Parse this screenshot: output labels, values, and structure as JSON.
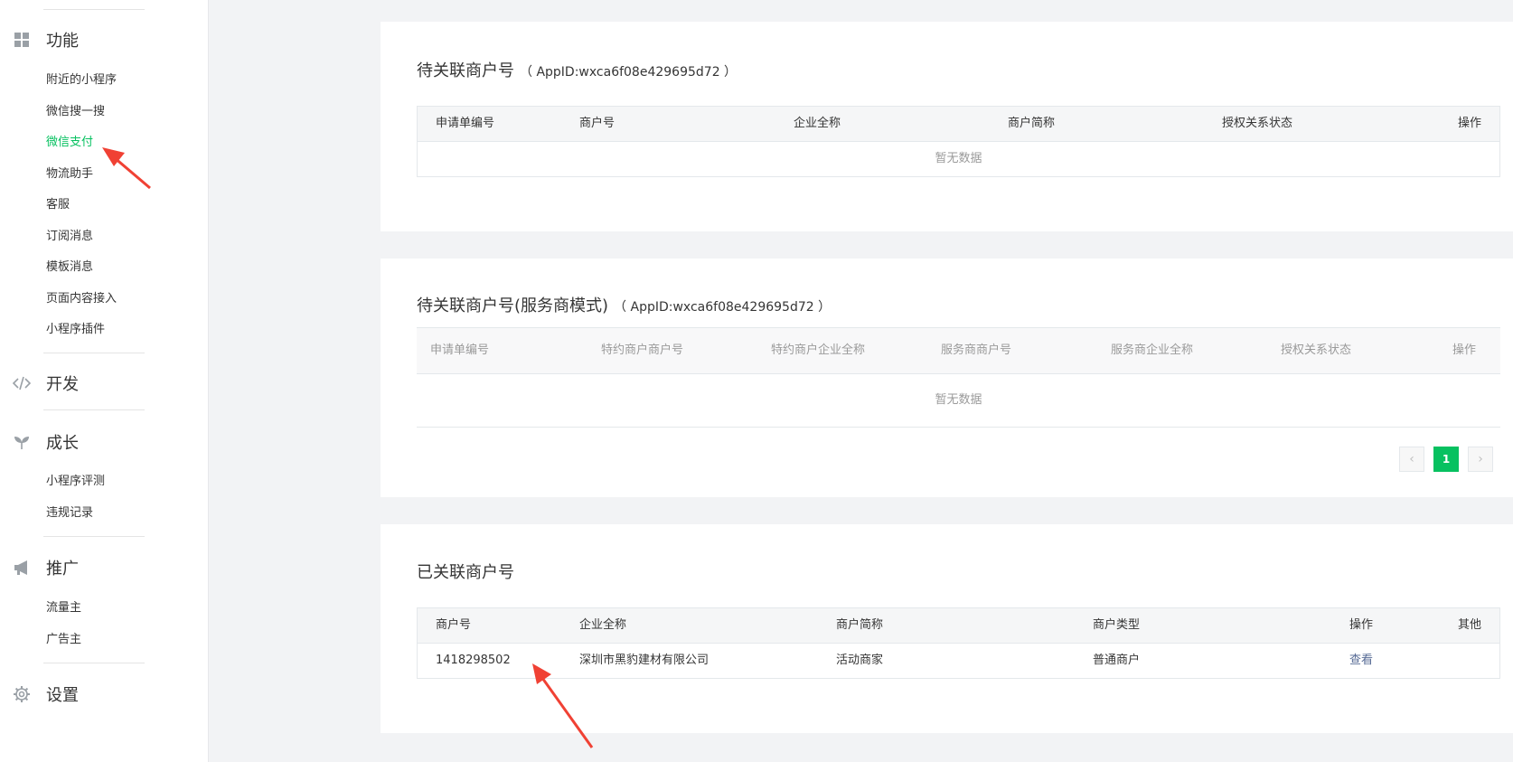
{
  "sidebar": {
    "sections": [
      {
        "title": "功能",
        "icon": "grid-icon"
      },
      {
        "title": "开发",
        "icon": "code-icon"
      },
      {
        "title": "成长",
        "icon": "sprout-icon"
      },
      {
        "title": "推广",
        "icon": "megaphone-icon"
      },
      {
        "title": "设置",
        "icon": "gear-icon"
      }
    ],
    "function_items": [
      "附近的小程序",
      "微信搜一搜",
      "微信支付",
      "物流助手",
      "客服",
      "订阅消息",
      "模板消息",
      "页面内容接入",
      "小程序插件"
    ],
    "growth_items": [
      "小程序评测",
      "违规记录"
    ],
    "promo_items": [
      "流量主",
      "广告主"
    ],
    "active_item": "微信支付"
  },
  "pending": {
    "title": "待关联商户号",
    "appid": "（ AppID:wxca6f08e429695d72 ）",
    "columns": [
      "申请单编号",
      "商户号",
      "企业全称",
      "商户简称",
      "授权关系状态",
      "操作"
    ],
    "empty_text": "暂无数据"
  },
  "pending_sp": {
    "title": "待关联商户号(服务商模式)",
    "appid": "（ AppID:wxca6f08e429695d72 ）",
    "columns": [
      "申请单编号",
      "特约商户商户号",
      "特约商户企业全称",
      "服务商商户号",
      "服务商企业全称",
      "授权关系状态",
      "操作"
    ],
    "empty_text": "暂无数据",
    "pagination": {
      "prev": "‹",
      "current": "1",
      "next": "›"
    }
  },
  "linked": {
    "title": "已关联商户号",
    "columns": [
      "商户号",
      "企业全称",
      "商户简称",
      "商户类型",
      "操作",
      "其他"
    ],
    "rows": [
      {
        "merchant_id": "1418298502",
        "company": "深圳市黑豹建材有限公司",
        "short_name": "活动商家",
        "type": "普通商户",
        "action": "查看",
        "other": ""
      }
    ]
  },
  "colors": {
    "accent": "#07c160",
    "link": "#576b95",
    "annotation": "#f04134"
  }
}
